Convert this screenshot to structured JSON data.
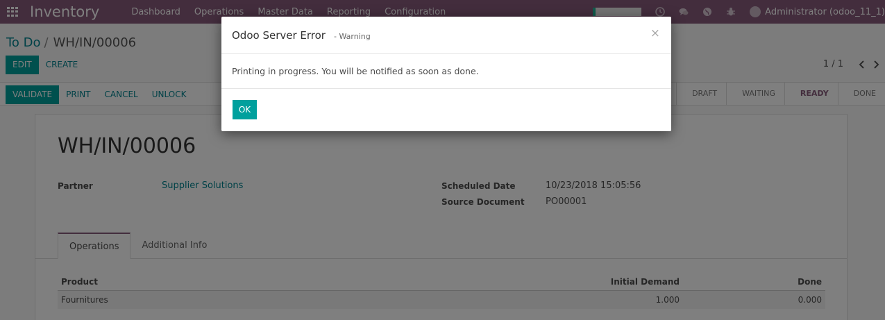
{
  "topnav": {
    "app_name": "Inventory",
    "menu": [
      "Dashboard",
      "Operations",
      "Master Data",
      "Reporting",
      "Configuration"
    ],
    "user": "Administrator (odoo_11_1)",
    "icons": [
      "apps-grid-icon",
      "clock-icon",
      "chat-icon",
      "globe-icon",
      "bug-icon"
    ]
  },
  "breadcrumb": {
    "parent": "To Do",
    "separator": "/",
    "current": "WH/IN/00006"
  },
  "control": {
    "edit": "Edit",
    "create": "Create",
    "pager": "1 / 1"
  },
  "statusbar": {
    "buttons": [
      "Validate",
      "Print",
      "Cancel",
      "Unlock"
    ],
    "stages": [
      "Draft",
      "Waiting",
      "Ready",
      "Done"
    ],
    "active_stage": "Ready"
  },
  "record": {
    "title": "WH/IN/00006",
    "partner_label": "Partner",
    "partner_value": "Supplier Solutions",
    "scheduled_label": "Scheduled Date",
    "scheduled_value": "10/23/2018 15:05:56",
    "source_label": "Source Document",
    "source_value": "PO00001"
  },
  "tabs": [
    "Operations",
    "Additional Info"
  ],
  "table": {
    "headers": {
      "product": "Product",
      "demand": "Initial Demand",
      "done": "Done"
    },
    "rows": [
      {
        "product": "Fournitures",
        "demand": "1.000",
        "done": "0.000"
      }
    ]
  },
  "modal": {
    "title": "Odoo Server Error",
    "subtitle": "- Warning",
    "close": "×",
    "message": "Printing in progress. You will be notified as soon as done.",
    "ok": "Ok"
  },
  "colors": {
    "brand": "#875a7b",
    "primary": "#00a09d",
    "link": "#00838f"
  }
}
